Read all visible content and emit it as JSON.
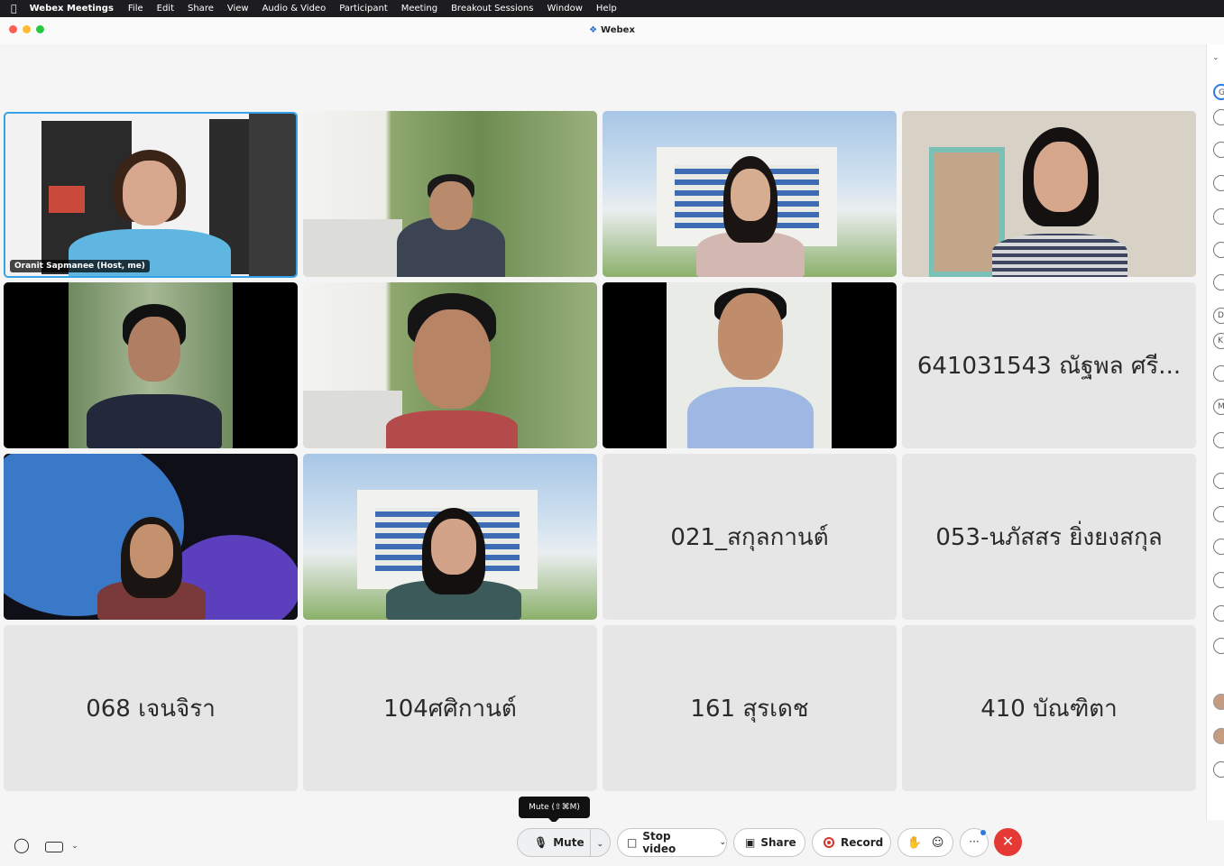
{
  "menubar": {
    "app_name": "Webex Meetings",
    "items": [
      "File",
      "Edit",
      "Share",
      "View",
      "Audio & Video",
      "Participant",
      "Meeting",
      "Breakout Sessions",
      "Window",
      "Help"
    ]
  },
  "window": {
    "title": "Webex"
  },
  "tiles": {
    "host_label": "Oranit Sapmanee  (Host, me)",
    "names": {
      "t8": "641031543 ณัฐพล ศรี...",
      "t11": "021_สกุลกานต์",
      "t12": "053-นภัสสร ยิ่งยงสกุล",
      "t13": "068 เจนจิรา",
      "t14": "104ศศิกานต์",
      "t15": "161 สุรเดช",
      "t16": "410 บัณฑิตา"
    }
  },
  "controls": {
    "mute_label": "Mute",
    "stop_video_label": "Stop video",
    "share_label": "Share",
    "record_label": "Record",
    "tooltip": "Mute (⇧⌘M)"
  },
  "strip": {
    "letters": [
      "D",
      "K",
      "M"
    ]
  }
}
